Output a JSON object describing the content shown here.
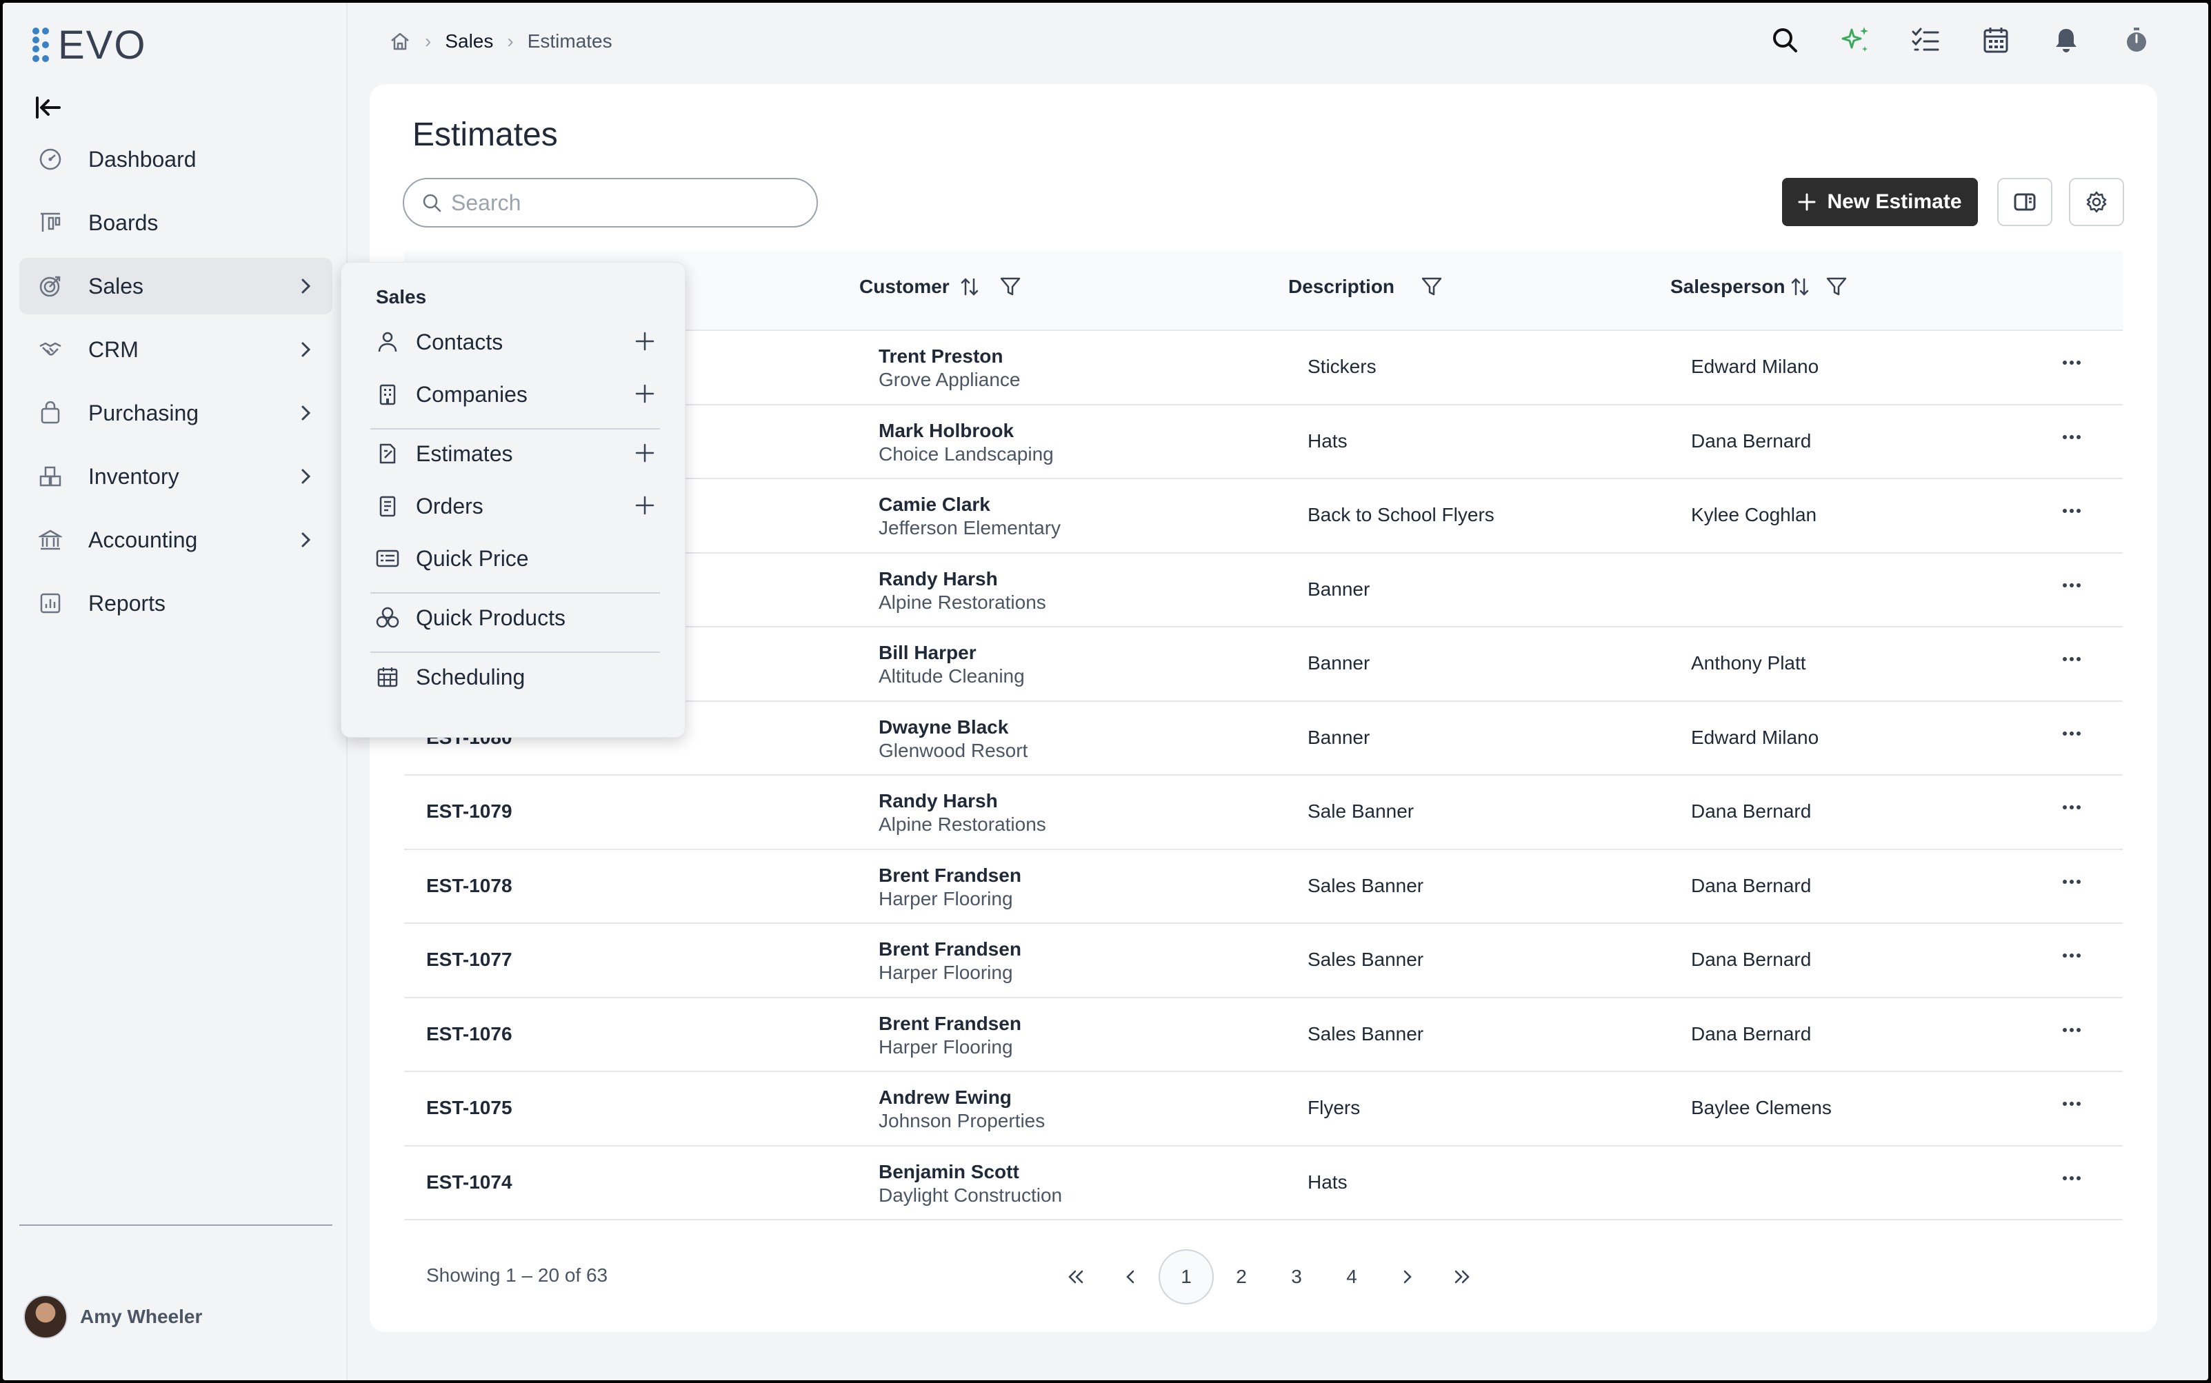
{
  "app": {
    "logo": "EVO",
    "accent": "#2d2d2d"
  },
  "sidebar": {
    "items": [
      {
        "label": "Dashboard",
        "icon": "dashboard-icon"
      },
      {
        "label": "Boards",
        "icon": "boards-icon"
      },
      {
        "label": "Sales",
        "icon": "sales-icon",
        "active": true
      },
      {
        "label": "CRM",
        "icon": "handshake-icon"
      },
      {
        "label": "Purchasing",
        "icon": "bag-icon"
      },
      {
        "label": "Inventory",
        "icon": "boxes-icon"
      },
      {
        "label": "Accounting",
        "icon": "bank-icon"
      },
      {
        "label": "Reports",
        "icon": "chart-icon"
      }
    ],
    "user": "Amy Wheeler"
  },
  "breadcrumb": {
    "section": "Sales",
    "page": "Estimates"
  },
  "page": {
    "title": "Estimates",
    "search_placeholder": "Search",
    "new_button": "New Estimate"
  },
  "table": {
    "columns": {
      "customer": "Customer",
      "description": "Description",
      "salesperson": "Salesperson"
    },
    "rows": [
      {
        "num": "",
        "name": "Trent Preston",
        "company": "Grove Appliance",
        "desc": "Stickers",
        "sp": "Edward Milano"
      },
      {
        "num": "",
        "name": "Mark Holbrook",
        "company": "Choice Landscaping",
        "desc": "Hats",
        "sp": "Dana Bernard"
      },
      {
        "num": "",
        "name": "Camie Clark",
        "company": "Jefferson Elementary",
        "desc": "Back to School Flyers",
        "sp": "Kylee Coghlan"
      },
      {
        "num": "",
        "name": "Randy Harsh",
        "company": "Alpine Restorations",
        "desc": "Banner",
        "sp": ""
      },
      {
        "num": "",
        "name": "Bill Harper",
        "company": "Altitude Cleaning",
        "desc": "Banner",
        "sp": "Anthony Platt"
      },
      {
        "num": "EST-1080",
        "name": "Dwayne Black",
        "company": "Glenwood Resort",
        "desc": "Banner",
        "sp": "Edward Milano"
      },
      {
        "num": "EST-1079",
        "name": "Randy Harsh",
        "company": "Alpine Restorations",
        "desc": "Sale Banner",
        "sp": "Dana Bernard"
      },
      {
        "num": "EST-1078",
        "name": "Brent Frandsen",
        "company": "Harper Flooring",
        "desc": "Sales Banner",
        "sp": "Dana Bernard"
      },
      {
        "num": "EST-1077",
        "name": "Brent Frandsen",
        "company": "Harper Flooring",
        "desc": "Sales Banner",
        "sp": "Dana Bernard"
      },
      {
        "num": "EST-1076",
        "name": "Brent Frandsen",
        "company": "Harper Flooring",
        "desc": "Sales Banner",
        "sp": "Dana Bernard"
      },
      {
        "num": "EST-1075",
        "name": "Andrew Ewing",
        "company": "Johnson Properties",
        "desc": "Flyers",
        "sp": "Baylee Clemens"
      },
      {
        "num": "EST-1074",
        "name": "Benjamin Scott",
        "company": "Daylight Construction",
        "desc": "Hats",
        "sp": ""
      }
    ]
  },
  "footer": {
    "showing": "Showing 1 – 20 of 63",
    "pages": [
      "1",
      "2",
      "3",
      "4"
    ],
    "current_page": "1"
  },
  "popover": {
    "title": "Sales",
    "items": [
      {
        "label": "Contacts",
        "icon": "person-icon",
        "add": true
      },
      {
        "label": "Companies",
        "icon": "building-icon",
        "add": true
      },
      {
        "label": "Estimates",
        "icon": "estimate-icon",
        "add": true
      },
      {
        "label": "Orders",
        "icon": "orders-icon",
        "add": true
      },
      {
        "label": "Quick Price",
        "icon": "price-card-icon",
        "add": false
      },
      {
        "label": "Quick Products",
        "icon": "products-icon",
        "add": false
      },
      {
        "label": "Scheduling",
        "icon": "calendar-grid-icon",
        "add": false
      }
    ]
  }
}
